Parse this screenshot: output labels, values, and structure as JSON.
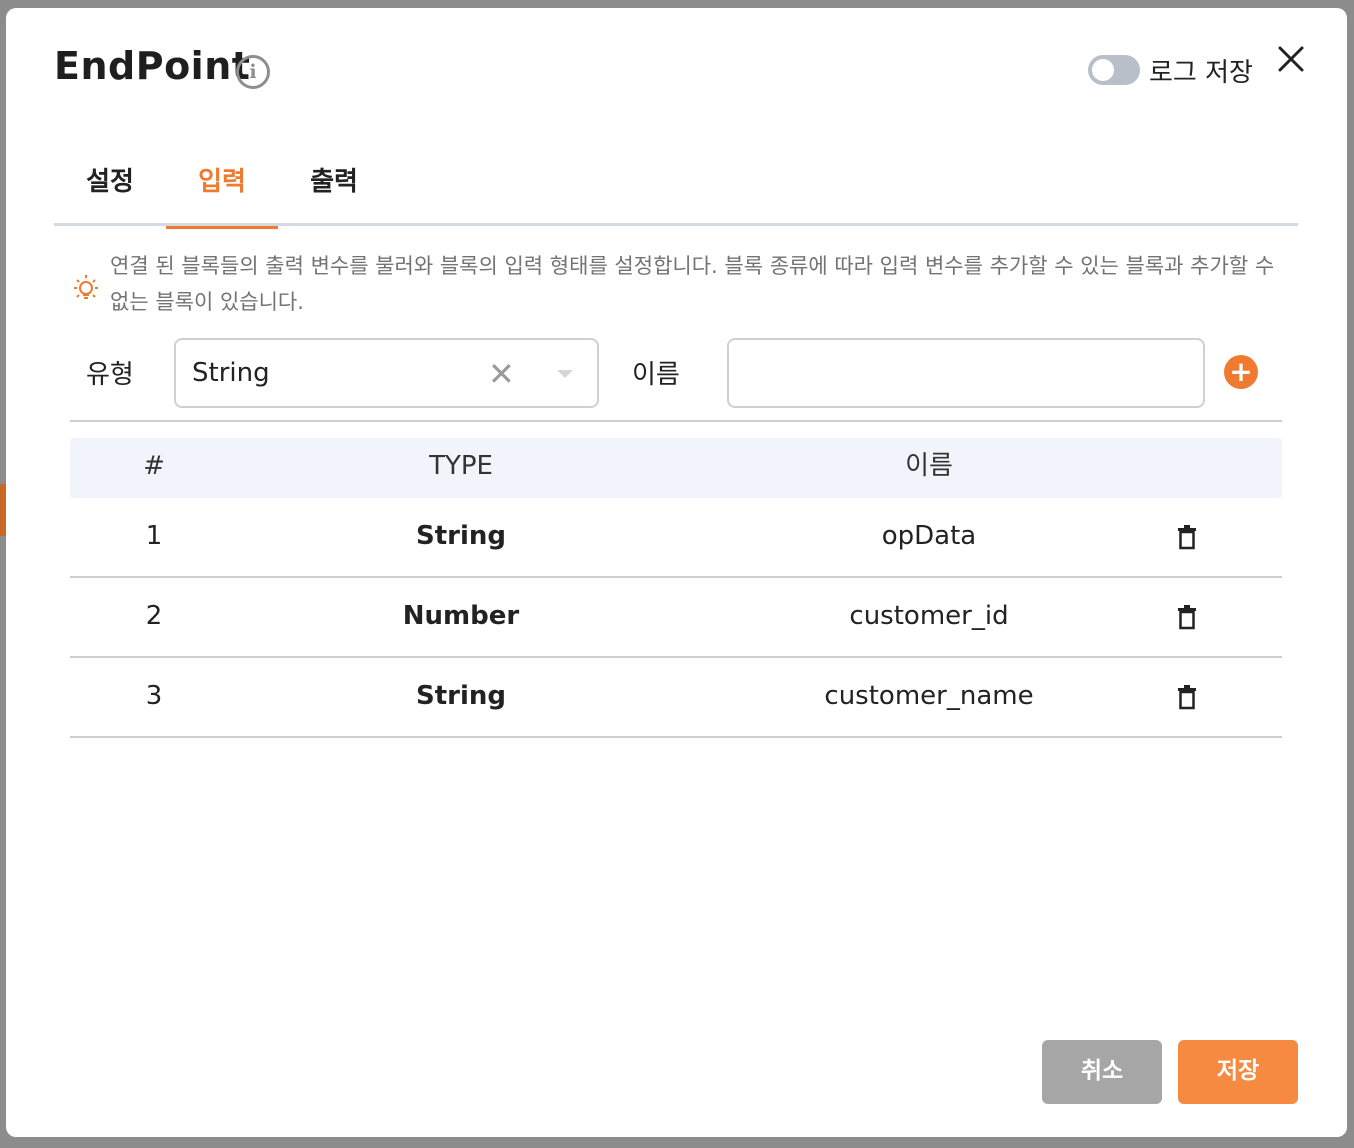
{
  "dialog": {
    "title": "EndPoint",
    "info_icon": "info-circle-icon",
    "log_toggle": {
      "label": "로그 저장",
      "enabled": false
    },
    "close_icon": "close-x-icon"
  },
  "tabs": [
    {
      "label": "설정",
      "active": false
    },
    {
      "label": "입력",
      "active": true
    },
    {
      "label": "출력",
      "active": false
    }
  ],
  "hint": {
    "icon": "lightbulb-icon",
    "text": "연결 된 블록들의 출력 변수를 불러와 블록의 입력 형태를 설정합니다. 블록 종류에 따라 입력 변수를 추가할 수 있는 블록과 추가할 수 없는 블록이 있습니다."
  },
  "form": {
    "type_label": "유형",
    "type_value": "String",
    "name_label": "이름",
    "name_value": "",
    "add_icon": "plus-circle-icon"
  },
  "table": {
    "headers": {
      "index": "#",
      "type": "TYPE",
      "name": "이름"
    },
    "rows": [
      {
        "index": "1",
        "type": "String",
        "name": "opData"
      },
      {
        "index": "2",
        "type": "Number",
        "name": "customer_id"
      },
      {
        "index": "3",
        "type": "String",
        "name": "customer_name"
      }
    ],
    "delete_icon": "trash-icon"
  },
  "footer": {
    "cancel_label": "취소",
    "save_label": "저장"
  },
  "colors": {
    "accent": "#ee7b2f",
    "save_button": "#f58a40",
    "cancel_button": "#a6a6a6",
    "header_bg": "#f2f4fb"
  }
}
